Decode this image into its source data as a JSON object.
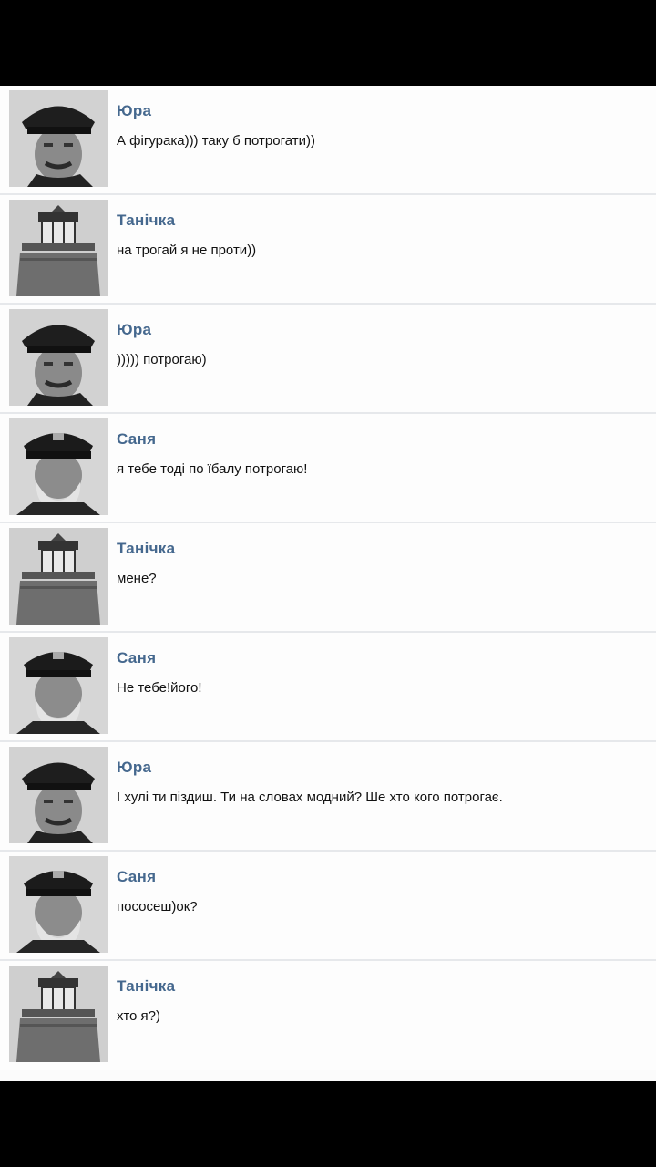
{
  "messages": [
    {
      "author": "Юра",
      "avatar": "young-keeper-avatar",
      "text": "А фігурака))) таку б потрогати))"
    },
    {
      "author": "Танічка",
      "avatar": "lighthouse-avatar",
      "text": "на трогай я не проти))"
    },
    {
      "author": "Юра",
      "avatar": "young-keeper-avatar",
      "text": "))))) потрогаю)"
    },
    {
      "author": "Саня",
      "avatar": "old-keeper-avatar",
      "text": "я тебе тоді по їбалу потрогаю!"
    },
    {
      "author": "Танічка",
      "avatar": "lighthouse-avatar",
      "text": "мене?"
    },
    {
      "author": "Саня",
      "avatar": "old-keeper-avatar",
      "text": "Не тебе!його!"
    },
    {
      "author": "Юра",
      "avatar": "young-keeper-avatar",
      "text": "І хулі ти піздиш. Ти на словах модний? Ше хто кого потрогає."
    },
    {
      "author": "Саня",
      "avatar": "old-keeper-avatar",
      "text": "пососеш)ок?"
    },
    {
      "author": "Танічка",
      "avatar": "lighthouse-avatar",
      "text": "хто я?)"
    }
  ],
  "colors": {
    "author_name": "#45688e",
    "message_text": "#111111",
    "divider": "#e6e8eb",
    "frame": "#000000"
  }
}
